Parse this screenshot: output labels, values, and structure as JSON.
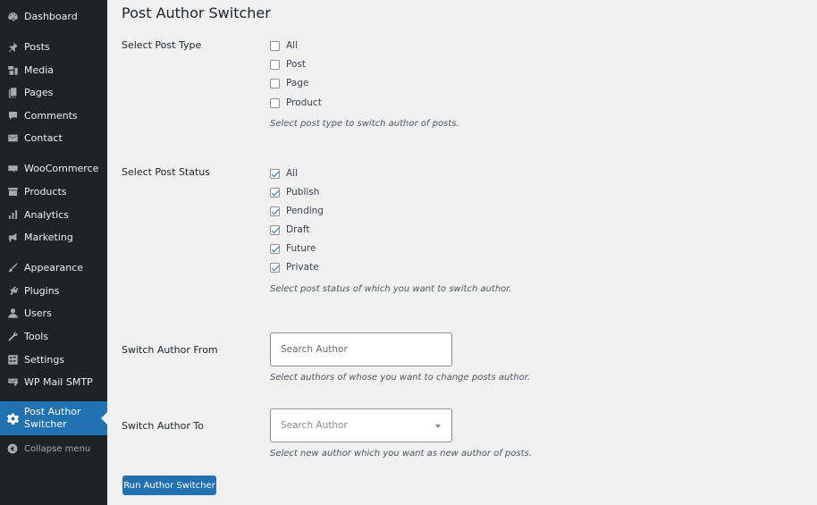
{
  "sidebar": {
    "items": [
      {
        "label": "Dashboard",
        "icon": "dashboard-icon"
      },
      {
        "label": "Posts",
        "icon": "pin-icon"
      },
      {
        "label": "Media",
        "icon": "media-icon"
      },
      {
        "label": "Pages",
        "icon": "pages-icon"
      },
      {
        "label": "Comments",
        "icon": "comment-icon"
      },
      {
        "label": "Contact",
        "icon": "envelope-icon"
      },
      {
        "label": "WooCommerce",
        "icon": "woo-icon"
      },
      {
        "label": "Products",
        "icon": "archive-icon"
      },
      {
        "label": "Analytics",
        "icon": "bar-chart-icon"
      },
      {
        "label": "Marketing",
        "icon": "megaphone-icon"
      },
      {
        "label": "Appearance",
        "icon": "brush-icon"
      },
      {
        "label": "Plugins",
        "icon": "plug-icon"
      },
      {
        "label": "Users",
        "icon": "user-icon"
      },
      {
        "label": "Tools",
        "icon": "wrench-icon"
      },
      {
        "label": "Settings",
        "icon": "settings-icon"
      },
      {
        "label": "WP Mail SMTP",
        "icon": "mail-smtp-icon"
      },
      {
        "label": "Post Author Switcher",
        "icon": "gear-icon",
        "active": true
      }
    ],
    "collapse_label": "Collapse menu"
  },
  "main": {
    "title": "Post Author Switcher",
    "post_type": {
      "label": "Select Post Type",
      "options": [
        {
          "label": "All",
          "checked": false
        },
        {
          "label": "Post",
          "checked": false
        },
        {
          "label": "Page",
          "checked": false
        },
        {
          "label": "Product",
          "checked": false
        }
      ],
      "description": "Select post type to switch author of posts."
    },
    "post_status": {
      "label": "Select Post Status",
      "options": [
        {
          "label": "All",
          "checked": true
        },
        {
          "label": "Publish",
          "checked": true
        },
        {
          "label": "Pending",
          "checked": true
        },
        {
          "label": "Draft",
          "checked": true
        },
        {
          "label": "Future",
          "checked": true
        },
        {
          "label": "Private",
          "checked": true
        }
      ],
      "description": "Select post status of which you want to switch author."
    },
    "author_from": {
      "label": "Switch Author From",
      "placeholder": "Search Author",
      "description": "Select authors of whose you want to change posts author."
    },
    "author_to": {
      "label": "Switch Author To",
      "placeholder": "Search Author",
      "description": "Select new author which you want as new author of posts."
    },
    "run_button": "Run Author Switcher"
  },
  "colors": {
    "sidebar_bg": "#1d2327",
    "accent": "#2271b1",
    "page_bg": "#f0f0f1"
  }
}
